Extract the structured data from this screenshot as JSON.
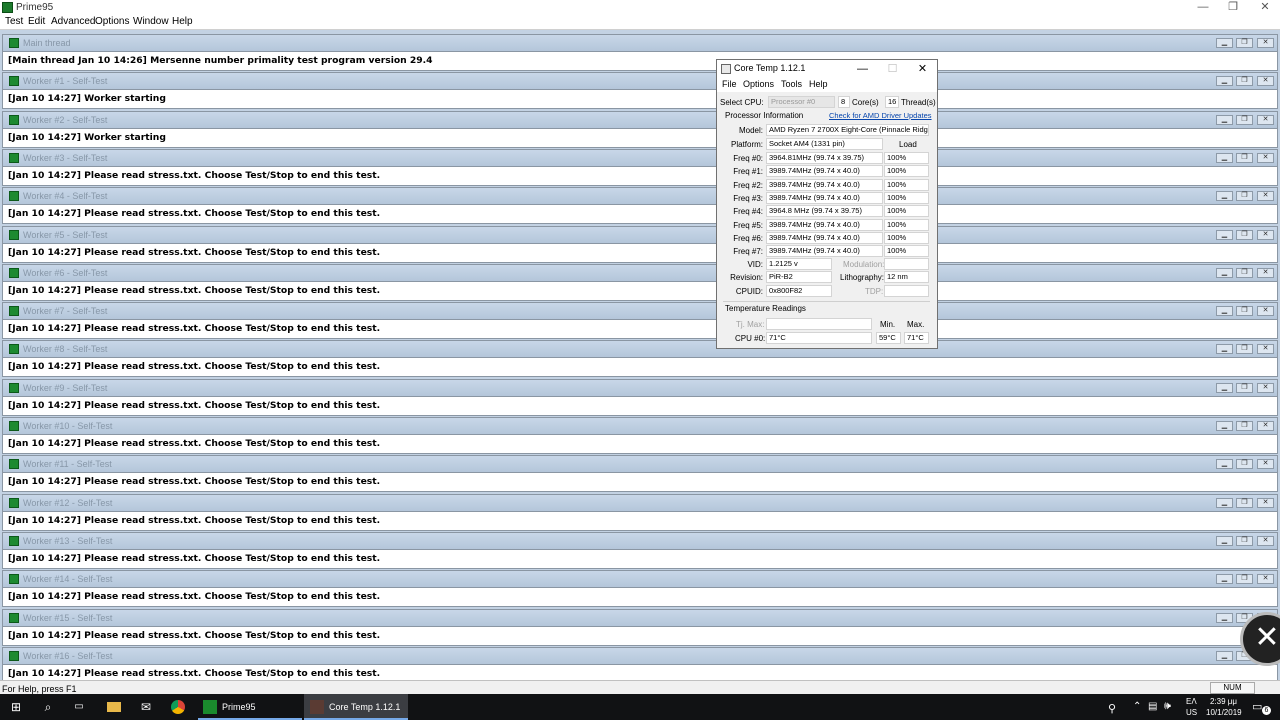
{
  "app": {
    "title": "Prime95",
    "menus": [
      "Test",
      "Edit",
      "Advanced",
      "Options",
      "Window",
      "Help"
    ],
    "window_controls": {
      "minimize": "—",
      "restore": "❐",
      "close": "✕"
    }
  },
  "children": [
    {
      "title": "Main thread",
      "line": "[Main thread Jan 10 14:26] Mersenne number primality test program version 29.4"
    },
    {
      "title": "Worker #1 - Self-Test",
      "line": "[Jan 10 14:27] Worker starting"
    },
    {
      "title": "Worker #2 - Self-Test",
      "line": "[Jan 10 14:27] Worker starting"
    },
    {
      "title": "Worker #3 - Self-Test",
      "line": "[Jan 10 14:27] Please read stress.txt.  Choose Test/Stop to end this test."
    },
    {
      "title": "Worker #4 - Self-Test",
      "line": "[Jan 10 14:27] Please read stress.txt.  Choose Test/Stop to end this test."
    },
    {
      "title": "Worker #5 - Self-Test",
      "line": "[Jan 10 14:27] Please read stress.txt.  Choose Test/Stop to end this test."
    },
    {
      "title": "Worker #6 - Self-Test",
      "line": "[Jan 10 14:27] Please read stress.txt.  Choose Test/Stop to end this test."
    },
    {
      "title": "Worker #7 - Self-Test",
      "line": "[Jan 10 14:27] Please read stress.txt.  Choose Test/Stop to end this test."
    },
    {
      "title": "Worker #8 - Self-Test",
      "line": "[Jan 10 14:27] Please read stress.txt.  Choose Test/Stop to end this test."
    },
    {
      "title": "Worker #9 - Self-Test",
      "line": "[Jan 10 14:27] Please read stress.txt.  Choose Test/Stop to end this test."
    },
    {
      "title": "Worker #10 - Self-Test",
      "line": "[Jan 10 14:27] Please read stress.txt.  Choose Test/Stop to end this test."
    },
    {
      "title": "Worker #11 - Self-Test",
      "line": "[Jan 10 14:27] Please read stress.txt.  Choose Test/Stop to end this test."
    },
    {
      "title": "Worker #12 - Self-Test",
      "line": "[Jan 10 14:27] Please read stress.txt.  Choose Test/Stop to end this test."
    },
    {
      "title": "Worker #13 - Self-Test",
      "line": "[Jan 10 14:27] Please read stress.txt.  Choose Test/Stop to end this test."
    },
    {
      "title": "Worker #14 - Self-Test",
      "line": "[Jan 10 14:27] Please read stress.txt.  Choose Test/Stop to end this test."
    },
    {
      "title": "Worker #15 - Self-Test",
      "line": "[Jan 10 14:27] Please read stress.txt.  Choose Test/Stop to end this test."
    },
    {
      "title": "Worker #16 - Self-Test",
      "line": "[Jan 10 14:27] Please read stress.txt.  Choose Test/Stop to end this test."
    }
  ],
  "status_bar": {
    "help_text": "For Help, press F1",
    "num": "NUM"
  },
  "coretemp": {
    "title": "Core Temp 1.12.1",
    "menus": [
      "File",
      "Options",
      "Tools",
      "Help"
    ],
    "select_cpu_label": "Select CPU:",
    "processor_value": "Processor #0",
    "cores_value": "8",
    "cores_label": "Core(s)",
    "threads_value": "16",
    "threads_label": "Thread(s)",
    "proc_info_label": "Processor Information",
    "driver_link": "Check for AMD Driver Updates",
    "model_label": "Model:",
    "model_value": "AMD Ryzen 7 2700X Eight-Core (Pinnacle Ridge)",
    "platform_label": "Platform:",
    "platform_value": "Socket AM4 (1331 pin)",
    "load_header": "Load",
    "freqs": [
      {
        "label": "Freq #0:",
        "value": "3964.81MHz (99.74 x 39.75)",
        "load": "100%"
      },
      {
        "label": "Freq #1:",
        "value": "3989.74MHz (99.74 x 40.0)",
        "load": "100%"
      },
      {
        "label": "Freq #2:",
        "value": "3989.74MHz (99.74 x 40.0)",
        "load": "100%"
      },
      {
        "label": "Freq #3:",
        "value": "3989.74MHz (99.74 x 40.0)",
        "load": "100%"
      },
      {
        "label": "Freq #4:",
        "value": "3964.8 MHz (99.74 x 39.75)",
        "load": "100%"
      },
      {
        "label": "Freq #5:",
        "value": "3989.74MHz (99.74 x 40.0)",
        "load": "100%"
      },
      {
        "label": "Freq #6:",
        "value": "3989.74MHz (99.74 x 40.0)",
        "load": "100%"
      },
      {
        "label": "Freq #7:",
        "value": "3989.74MHz (99.74 x 40.0)",
        "load": "100%"
      }
    ],
    "vid_label": "VID:",
    "vid_value": "1.2125 v",
    "modulation_label": "Modulation:",
    "revision_label": "Revision:",
    "revision_value": "PiR-B2",
    "lithography_label": "Lithography:",
    "lithography_value": "12 nm",
    "cpuid_label": "CPUID:",
    "cpuid_value": "0x800F82",
    "tdp_label": "TDP:",
    "temp_header": "Temperature Readings",
    "tjmax_label": "Tj. Max:",
    "min_label": "Min.",
    "max_label": "Max.",
    "cpu0_label": "CPU #0:",
    "cpu0_value": "71°C",
    "cpu0_min": "59°C",
    "cpu0_max": "71°C"
  },
  "taskbar": {
    "apps": [
      {
        "label": "Prime95",
        "color": "#1a8a2d"
      },
      {
        "label": "Core Temp 1.12.1",
        "color": "#5a3b33"
      }
    ],
    "lang_top": "ΕΛ",
    "lang_bottom": "US",
    "time": "2:39 μμ",
    "date": "10/1/2019",
    "notification_count": "6"
  }
}
